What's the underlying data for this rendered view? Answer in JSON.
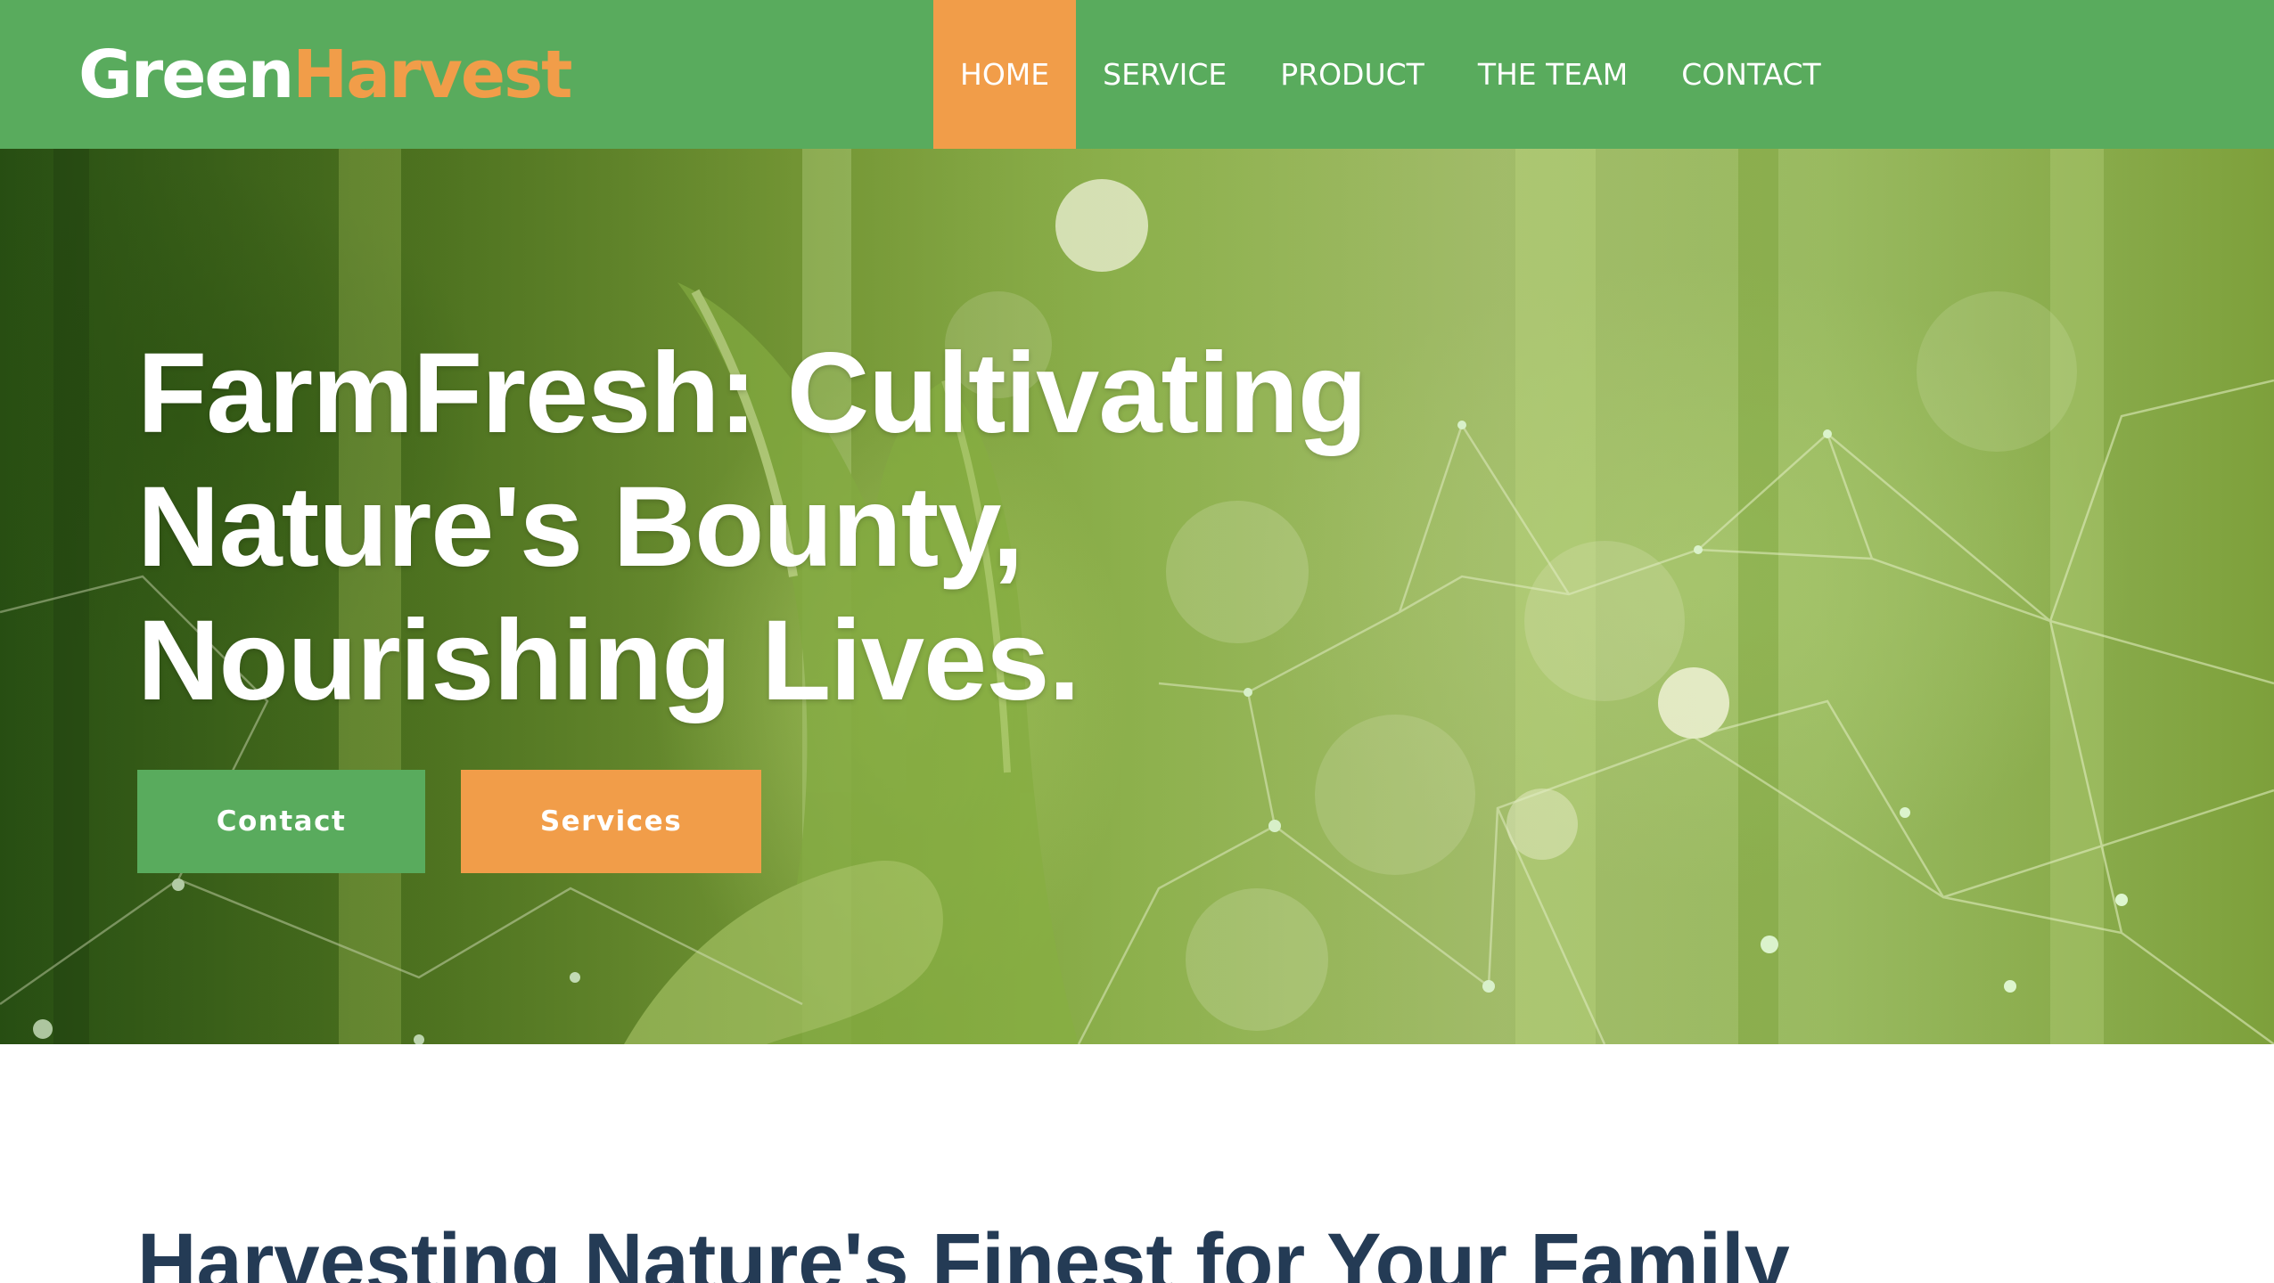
{
  "header": {
    "brand": {
      "part1": "Green",
      "part2": "Harvest"
    },
    "nav": [
      {
        "label": "HOME",
        "active": true
      },
      {
        "label": "SERVICE",
        "active": false
      },
      {
        "label": "PRODUCT",
        "active": false
      },
      {
        "label": "THE TEAM",
        "active": false
      },
      {
        "label": "CONTACT",
        "active": false
      }
    ]
  },
  "hero": {
    "title_line1": "FarmFresh: Cultivating",
    "title_line2": "Nature's Bounty,",
    "title_line3": "Nourishing Lives.",
    "primary_button": "Contact",
    "secondary_button": "Services"
  },
  "section": {
    "title": "Harvesting Nature's Finest for Your Family"
  },
  "colors": {
    "brand_green": "#59ab5d",
    "brand_orange": "#f19d49",
    "heading_navy": "#243b55"
  }
}
